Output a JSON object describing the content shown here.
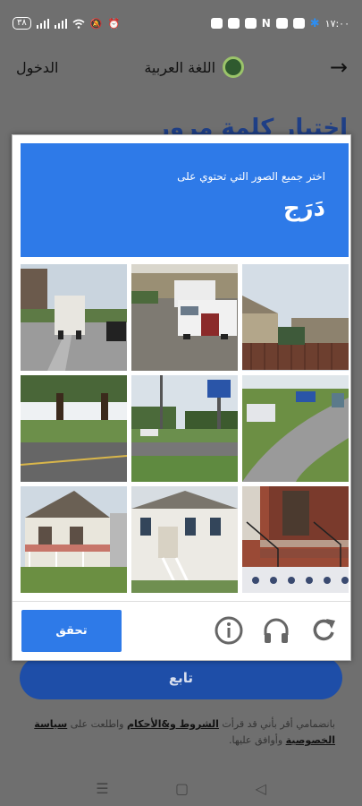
{
  "status": {
    "time": "١٧:٠٠",
    "battery": "٣٨"
  },
  "appbar": {
    "login": "الدخول",
    "language": "اللغة العربية"
  },
  "background_title": "اختيار كلمة مرور",
  "captcha": {
    "instruction": "اختر جميع الصور التي تحتوي على",
    "target_word": "دَرَج",
    "tiles": [
      {
        "name": "tile-street-truck"
      },
      {
        "name": "tile-parking-vans"
      },
      {
        "name": "tile-house-fence"
      },
      {
        "name": "tile-road-trees"
      },
      {
        "name": "tile-street-sign"
      },
      {
        "name": "tile-curved-road"
      },
      {
        "name": "tile-house-porch"
      },
      {
        "name": "tile-house-stairs"
      },
      {
        "name": "tile-brick-stairs"
      }
    ],
    "verify_label": "تحقق",
    "icons": [
      "info-icon",
      "audio-icon",
      "refresh-icon"
    ]
  },
  "continue_label": "تابع",
  "terms": {
    "prefix": "بانضمامي أقر بأني قد قرأت",
    "terms_link": "الشروط و&الأحكام",
    "middle": "واطلعت على",
    "privacy_link": "سياسة الخصوصية",
    "suffix": "وأوافق عليها."
  },
  "colors": {
    "accent": "#2e7ae8",
    "button": "#1e4ea8",
    "overlay": "#6f6f6f"
  }
}
